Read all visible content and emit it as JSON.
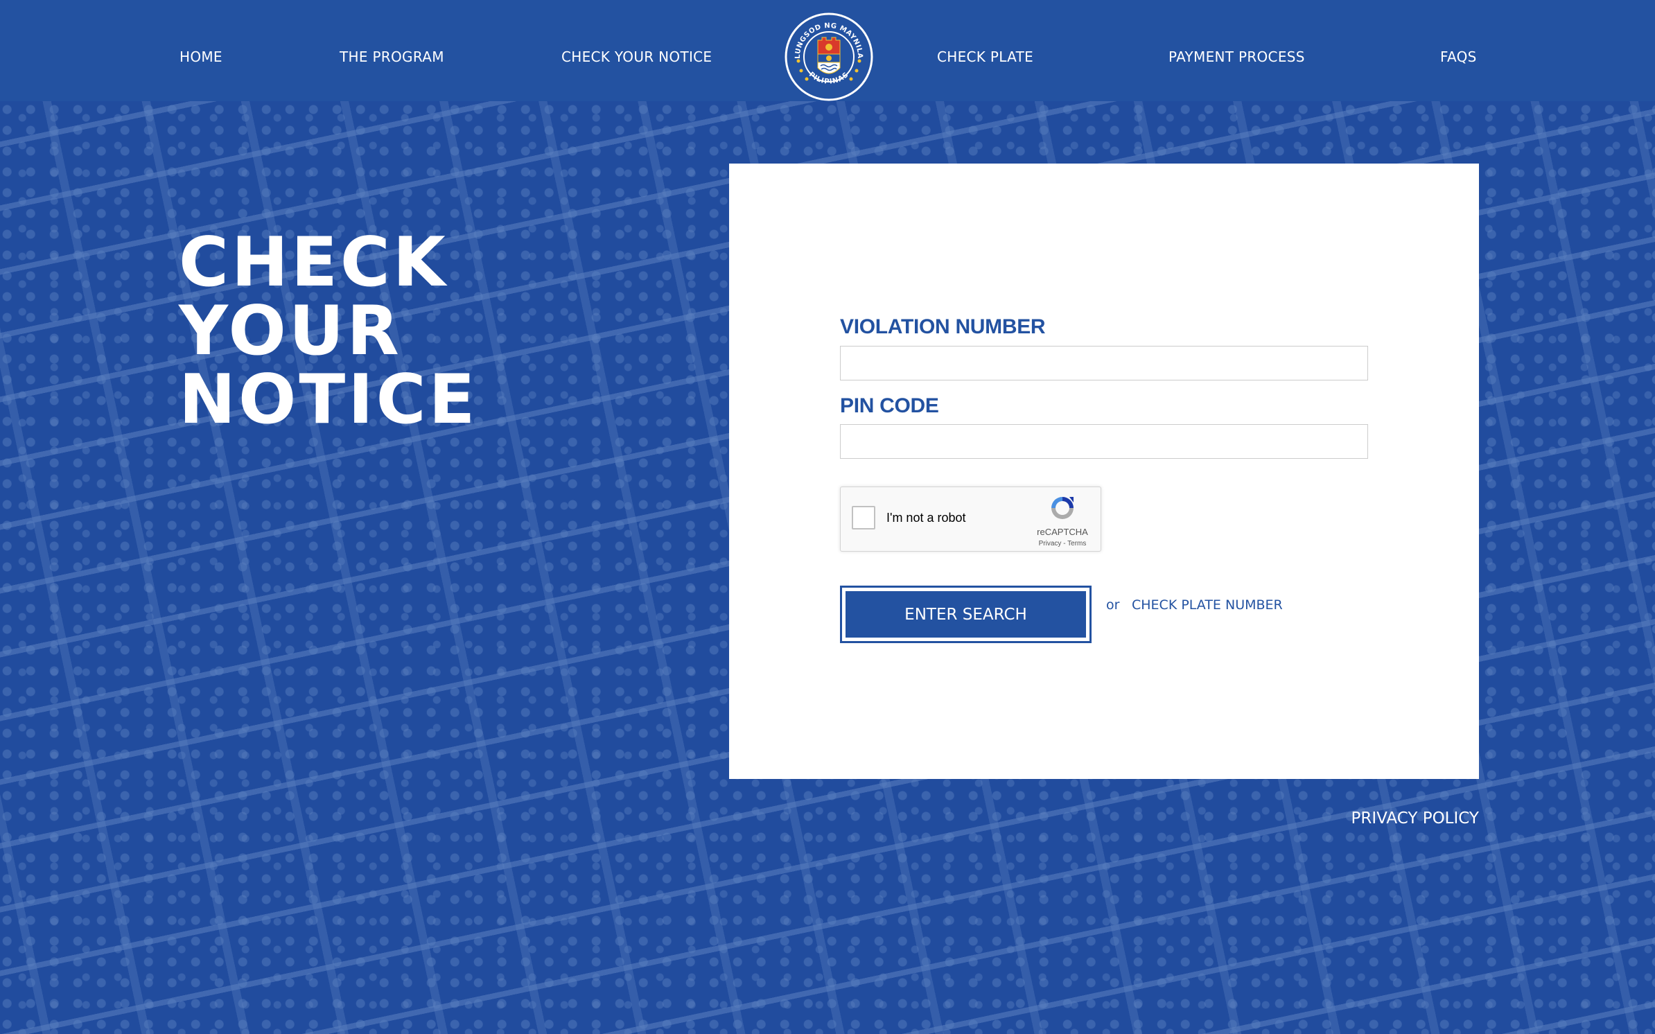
{
  "nav": {
    "items": [
      {
        "label": "HOME"
      },
      {
        "label": "THE PROGRAM"
      },
      {
        "label": "CHECK YOUR NOTICE"
      },
      {
        "label": "CHECK PLATE"
      },
      {
        "label": "PAYMENT PROCESS"
      },
      {
        "label": "FAQS"
      }
    ],
    "logo": {
      "top_text": "LUNGSOD NG MAYNILA",
      "bottom_text": "PILIPINAS",
      "icon": "manila-city-seal-icon"
    }
  },
  "hero": {
    "title_lines": [
      "CHECK",
      "YOUR",
      "NOTICE"
    ]
  },
  "form": {
    "violation_label": "VIOLATION NUMBER",
    "violation_value": "",
    "pin_label": "PIN CODE",
    "pin_value": "",
    "captcha": {
      "label": "I'm not a robot",
      "brand": "reCAPTCHA",
      "privacy": "Privacy",
      "separator": "-",
      "terms": "Terms",
      "checked": false,
      "icon": "recaptcha-icon"
    },
    "submit_label": "ENTER SEARCH",
    "or_text": "or",
    "alt_link": "CHECK PLATE NUMBER"
  },
  "footer": {
    "privacy_policy": "PRIVACY POLICY"
  },
  "colors": {
    "brand_blue": "#2352A1",
    "background_dark": "#214C9E",
    "background_light": "#5B80C0",
    "card": "#FFFFFF"
  }
}
